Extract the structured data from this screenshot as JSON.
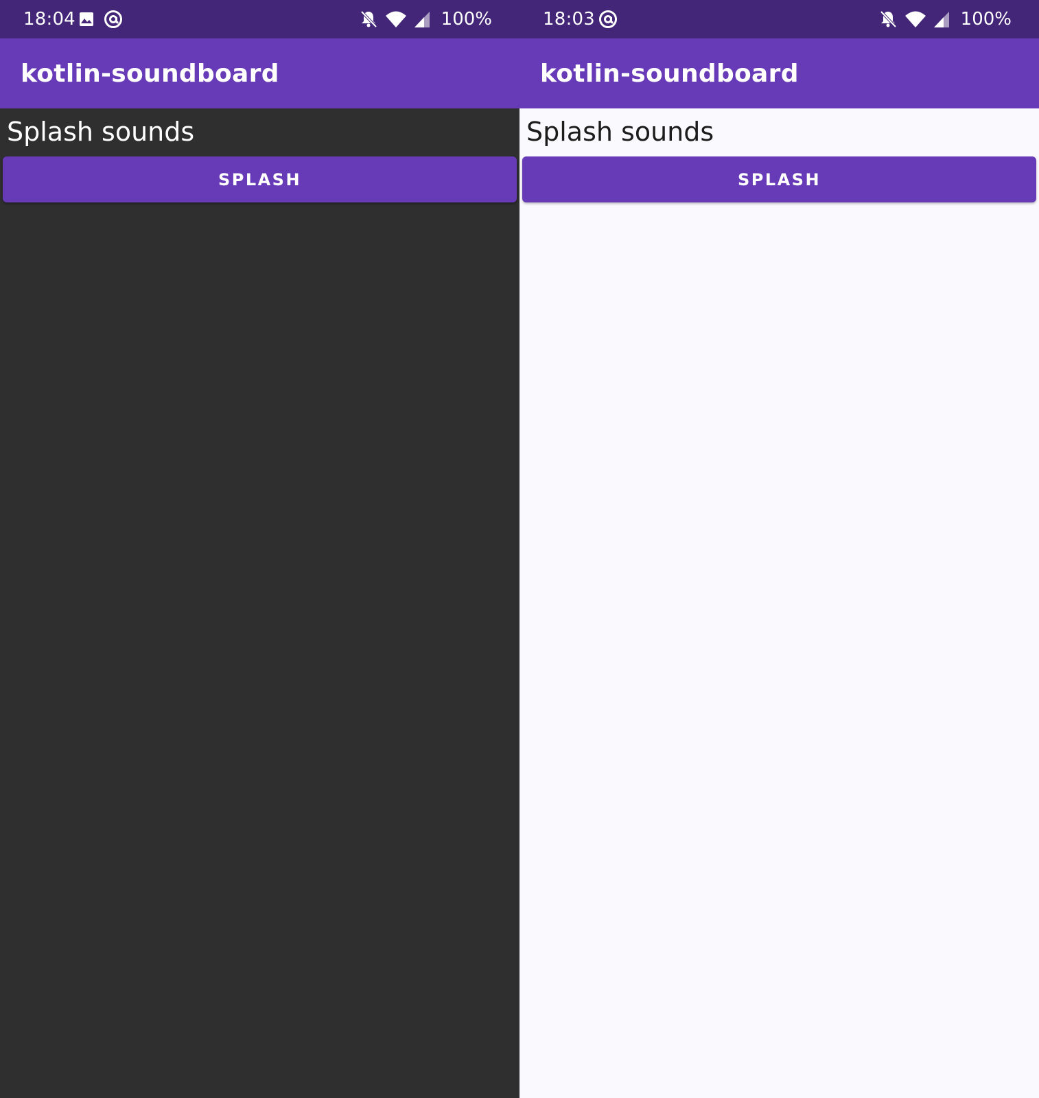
{
  "screens": [
    {
      "theme": "dark",
      "status_bar": {
        "time": "18:04",
        "left_icons": [
          "image-icon",
          "at-sign-icon"
        ],
        "right_icons": [
          "bell-off-icon",
          "wifi-icon",
          "cell-signal-icon"
        ],
        "battery": "100%"
      },
      "app_bar": {
        "title": "kotlin-soundboard"
      },
      "content": {
        "section_title": "Splash sounds",
        "button_label": "SPLASH"
      }
    },
    {
      "theme": "light",
      "status_bar": {
        "time": "18:03",
        "left_icons": [
          "at-sign-icon"
        ],
        "right_icons": [
          "bell-off-icon",
          "wifi-icon",
          "cell-signal-icon"
        ],
        "battery": "100%"
      },
      "app_bar": {
        "title": "kotlin-soundboard"
      },
      "content": {
        "section_title": "Splash sounds",
        "button_label": "SPLASH"
      }
    }
  ],
  "colors": {
    "status_bar": "#432677",
    "primary": "#673ab7",
    "dark_background": "#2f2f2f",
    "light_background": "#fafafe"
  }
}
